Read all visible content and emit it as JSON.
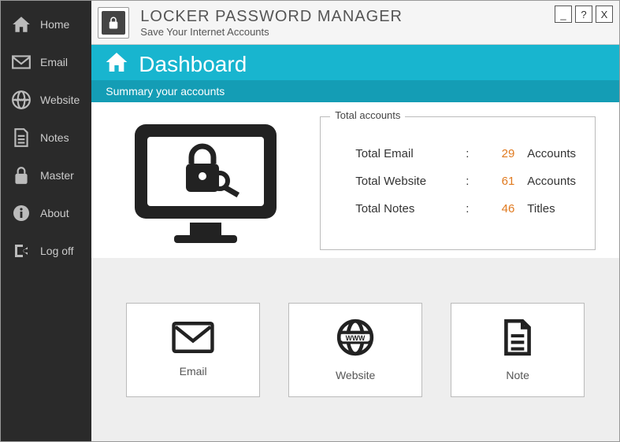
{
  "sidebar": {
    "items": [
      {
        "label": "Home"
      },
      {
        "label": "Email"
      },
      {
        "label": "Website"
      },
      {
        "label": "Notes"
      },
      {
        "label": "Master"
      },
      {
        "label": "About"
      },
      {
        "label": "Log off"
      }
    ]
  },
  "header": {
    "title": "LOCKER PASSWORD MANAGER",
    "subtitle": "Save Your Internet Accounts",
    "minimize": "_",
    "help": "?",
    "close": "X"
  },
  "dashboard": {
    "title": "Dashboard",
    "subtitle": "Summary your accounts"
  },
  "totals": {
    "legend": "Total accounts",
    "rows": [
      {
        "label": "Total Email",
        "sep": ":",
        "value": "29",
        "unit": "Accounts"
      },
      {
        "label": "Total Website",
        "sep": ":",
        "value": "61",
        "unit": "Accounts"
      },
      {
        "label": "Total Notes",
        "sep": ":",
        "value": "46",
        "unit": "Titles"
      }
    ]
  },
  "cards": [
    {
      "label": "Email"
    },
    {
      "label": "Website"
    },
    {
      "label": "Note"
    }
  ]
}
